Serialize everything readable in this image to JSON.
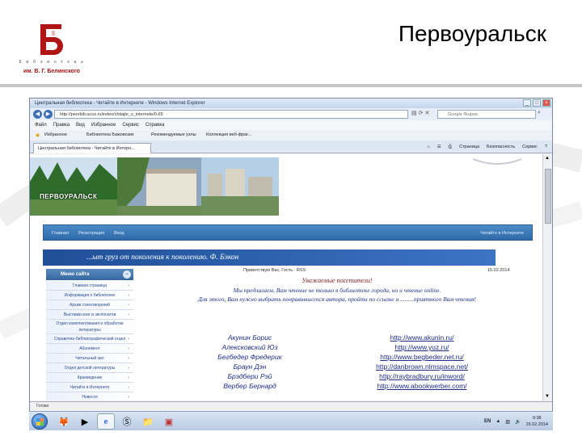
{
  "slide": {
    "title": "Первоуральск",
    "logo_letter": "Б",
    "logo_small": "Б и б л и о т е к а",
    "logo_name": "им. В. Г. Белинского"
  },
  "browser": {
    "window_title": "Центральная библиотека - Читайте в Интернете - Windows Internet Explorer",
    "address": "http://pervbib.ucoz.ru/index/chitajte_v_internete/0-65",
    "search_placeholder": "Google Яндекс",
    "menu": [
      "Файл",
      "Правка",
      "Вид",
      "Избранное",
      "Сервис",
      "Справка"
    ],
    "favorites": [
      "Избранное",
      "Библиотека Бажовских",
      "Рекомендуемые узлы",
      "Коллекция веб-фраг..."
    ],
    "tab_label": "Центральная библиотека - Читайте в Интерн...",
    "command_bar": [
      "Страница",
      "Безопасность",
      "Сервис"
    ],
    "status_text": "Готово"
  },
  "site": {
    "banner_text": "ПЕРВОУРАЛЬСК",
    "nav_left": [
      "Главная",
      "Регистрация",
      "Вход"
    ],
    "nav_right": "Читайте в Интернете",
    "quote": "...ыт груз от поколения к поколению.   Ф. Бэкон",
    "guest_line": "Приветствую Вас, Гость · RSS",
    "date_line": "15.02.2014",
    "sidebar_title": "Меню сайта",
    "sidebar_items": [
      "Главная страница",
      "Информация о библиотеке",
      "Архив стихотворений",
      "Выставки книг и экспонатов",
      "Отдел комплектования и обработки литературы",
      "Справочно-библиографический отдел",
      "Абонемент",
      "Читальный зал",
      "Отдел детской литературы",
      "Краеведение",
      "Читайте в Интернете",
      "Новости"
    ],
    "notice_title": "Уважаемые посетители!",
    "notice_lines": [
      "Мы предлагаем, Вам чтение не только в библиотеке города, но и чтение online.",
      "Для этого, Вам нужно выбрать понравившегося автора, пройти по ссылке и .........приятного Вам чтения!"
    ],
    "authors": [
      "Акунин Борис",
      "Алексковский Юз",
      "Бегбедер Фредерик",
      "Браун Дэн",
      "Брэдбери Рэй",
      "Вербер Бернард"
    ],
    "links": [
      "http://www.akunin.ru/",
      "http://www.yuz.ru/",
      "http://www.begbeder.net.ru/",
      "http://danbrown.nlmspace.net/",
      "http://raybradbury.ru/inword/",
      "http://www.abookwerber.com/"
    ]
  },
  "taskbar": {
    "lang": "EN",
    "time": "9:38",
    "date": "15.02.2014"
  },
  "colors": {
    "accent_blue": "#2e6aa8",
    "link_blue": "#1f2e86",
    "logo_red": "#a11111"
  }
}
